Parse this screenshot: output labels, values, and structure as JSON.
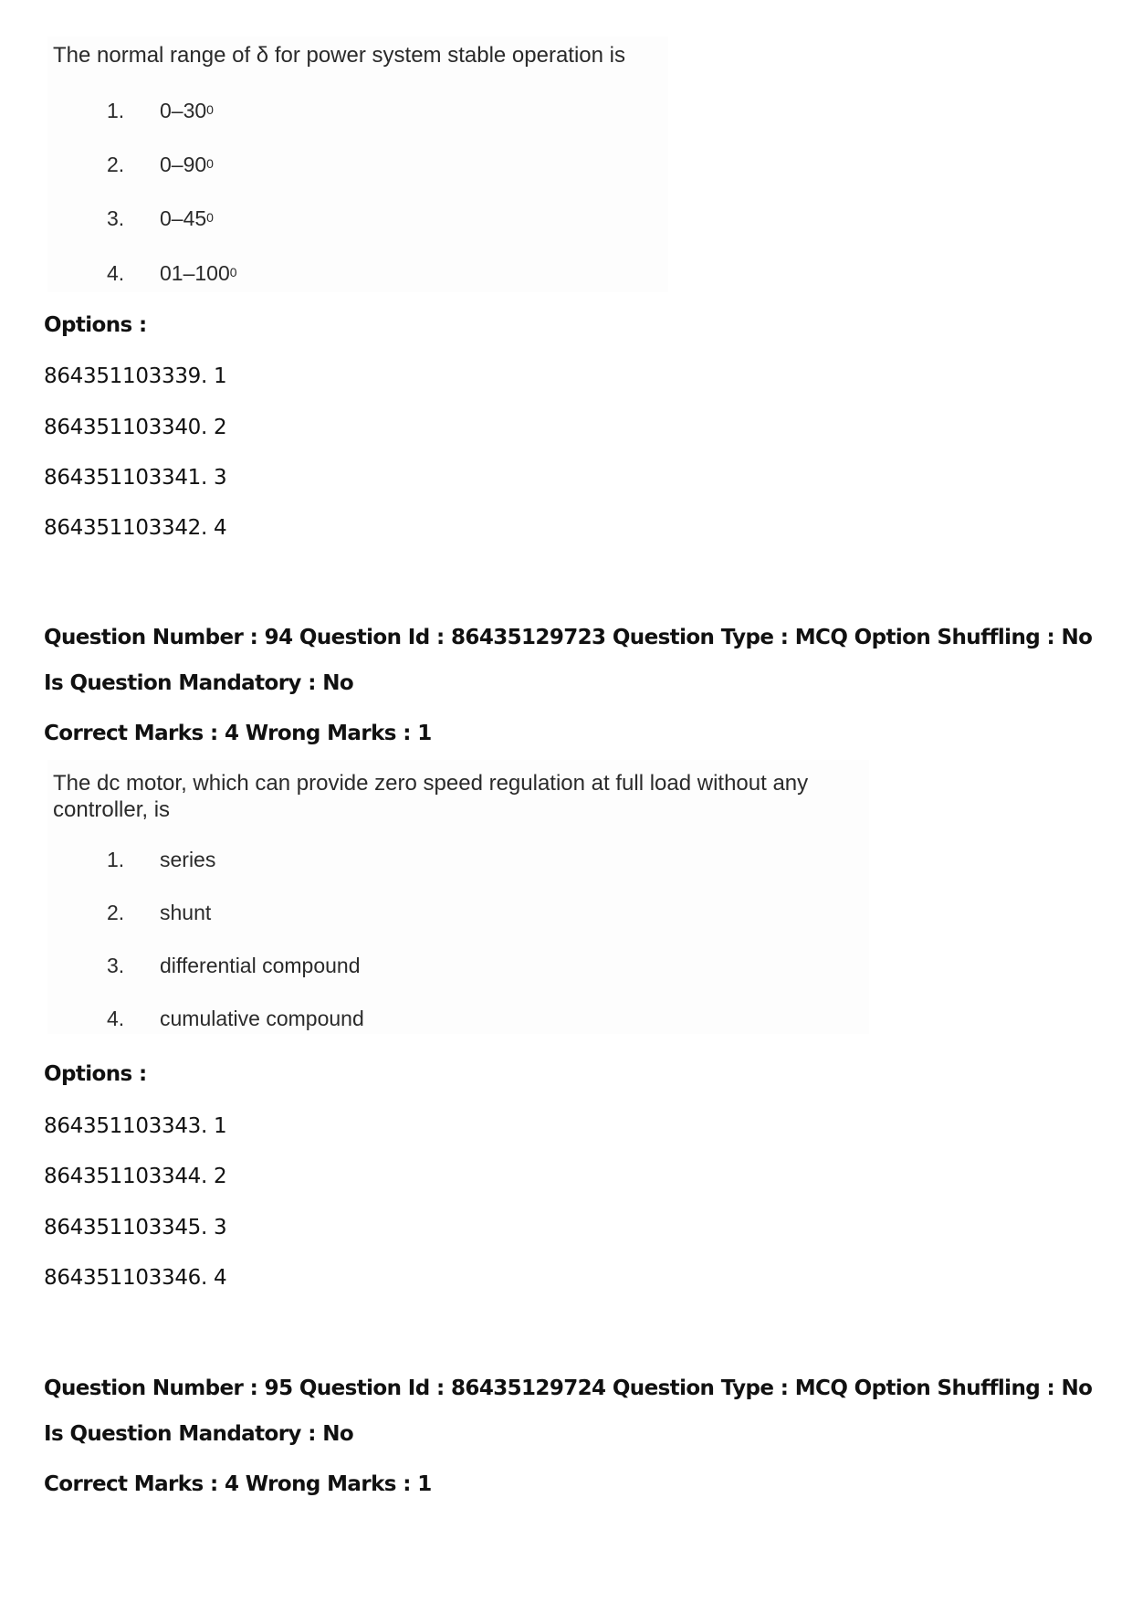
{
  "question_93_tail": {
    "question_text": "The normal range of δ for power system stable operation is",
    "choices": [
      {
        "num": "1.",
        "text": "0–30",
        "sup": "0"
      },
      {
        "num": "2.",
        "text": "0–90",
        "sup": "0"
      },
      {
        "num": "3.",
        "text": "0–45",
        "sup": "0"
      },
      {
        "num": "4.",
        "text": "01–100",
        "sup": "0"
      }
    ],
    "options_label": "Options :",
    "options": [
      "864351103339. 1",
      "864351103340. 2",
      "864351103341. 3",
      "864351103342. 4"
    ]
  },
  "question_94": {
    "header": "Question Number : 94 Question Id : 86435129723 Question Type : MCQ Option Shuffling : No",
    "mandatory": "Is Question Mandatory : No",
    "marks": "Correct Marks : 4 Wrong Marks : 1",
    "question_text_line1": "The dc motor, which can provide zero speed regulation at full load without any",
    "question_text_line2": "controller, is",
    "choices": [
      {
        "num": "1.",
        "text": "series"
      },
      {
        "num": "2.",
        "text": "shunt"
      },
      {
        "num": "3.",
        "text": "differential compound"
      },
      {
        "num": "4.",
        "text": "cumulative compound"
      }
    ],
    "options_label": "Options :",
    "options": [
      "864351103343. 1",
      "864351103344. 2",
      "864351103345. 3",
      "864351103346. 4"
    ]
  },
  "question_95": {
    "header": "Question Number : 95 Question Id : 86435129724 Question Type : MCQ Option Shuffling : No",
    "mandatory": "Is Question Mandatory : No",
    "marks": "Correct Marks : 4 Wrong Marks : 1"
  }
}
